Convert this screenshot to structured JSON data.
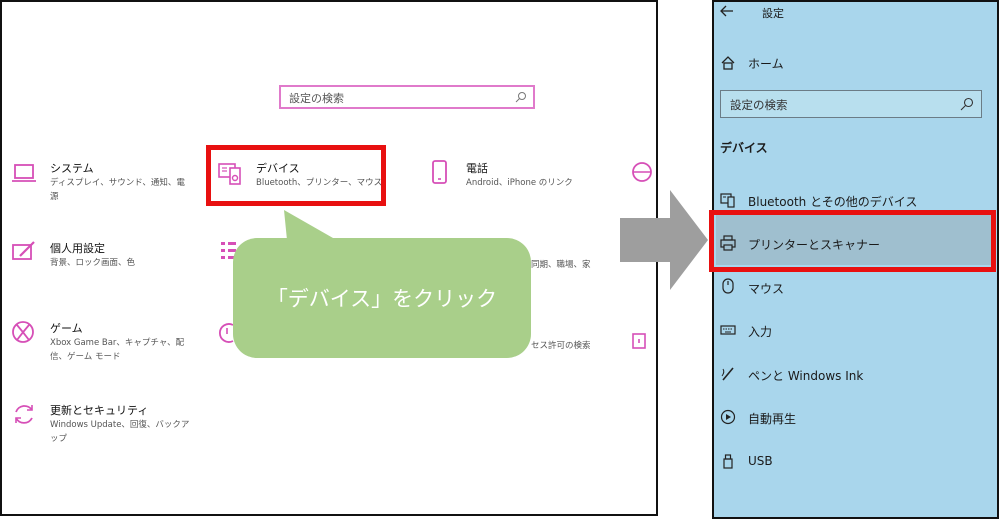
{
  "left": {
    "search_placeholder": "設定の検索",
    "tiles": [
      {
        "title": "システム",
        "subtitle": "ディスプレイ、サウンド、通知、電源"
      },
      {
        "title": "デバイス",
        "subtitle": "Bluetooth、プリンター、マウス"
      },
      {
        "title": "電話",
        "subtitle": "Android、iPhone のリンク"
      },
      {
        "title": "個人用設定",
        "subtitle": "背景、ロック画面、色"
      },
      {
        "title": "ゲーム",
        "subtitle": "Xbox Game Bar、キャプチャ、配信、ゲーム モード"
      },
      {
        "title": "更新とセキュリティ",
        "subtitle": "Windows Update、回復、バックアップ"
      }
    ],
    "partial_texts": {
      "row2_right": "同期、職場、家",
      "row3_right": "セス許可の検索"
    },
    "callout_text": "「デバイス」をクリック"
  },
  "right": {
    "title": "設定",
    "home": "ホーム",
    "search_placeholder": "設定の検索",
    "section": "デバイス",
    "items": [
      {
        "label": "Bluetooth とその他のデバイス",
        "icon": "bluetooth-device-icon"
      },
      {
        "label": "プリンターとスキャナー",
        "icon": "printer-icon"
      },
      {
        "label": "マウス",
        "icon": "mouse-icon"
      },
      {
        "label": "入力",
        "icon": "keyboard-icon"
      },
      {
        "label": "ペンと Windows Ink",
        "icon": "pen-icon"
      },
      {
        "label": "自動再生",
        "icon": "autoplay-icon"
      },
      {
        "label": "USB",
        "icon": "usb-icon"
      }
    ]
  },
  "colors": {
    "accent_pink": "#e07acb",
    "highlight_red": "#e81010",
    "callout_green": "#a9cf8a",
    "right_bg": "#a9d6ec",
    "arrow_gray": "#9e9e9e"
  }
}
